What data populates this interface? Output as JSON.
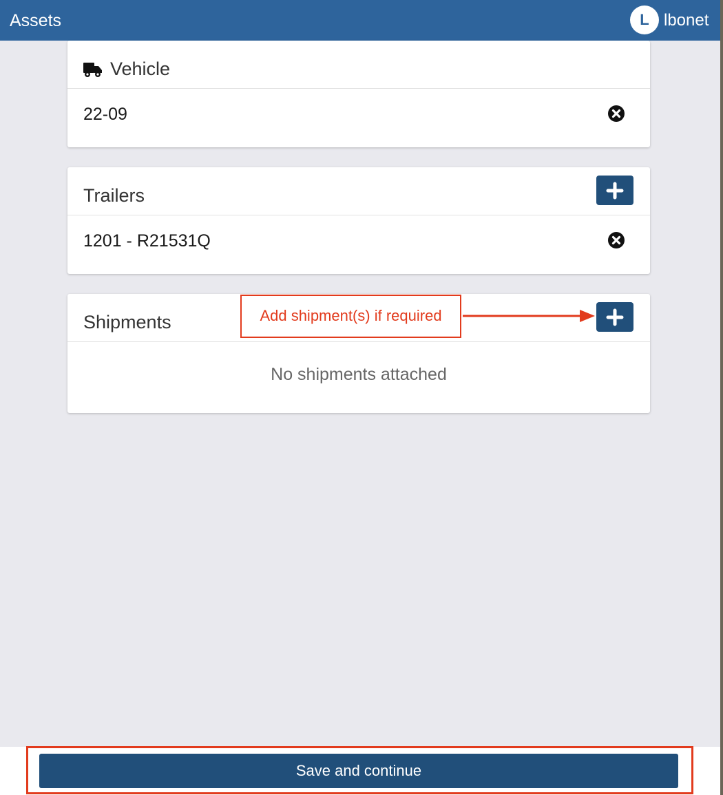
{
  "header": {
    "title": "Assets",
    "avatar_initial": "L",
    "username": "lbonet"
  },
  "vehicle": {
    "title": "Vehicle",
    "icon": "truck-icon",
    "item": "22-09"
  },
  "trailers": {
    "title": "Trailers",
    "items": [
      "1201 - R21531Q"
    ]
  },
  "shipments": {
    "title": "Shipments",
    "empty_text": "No shipments attached"
  },
  "annotation": {
    "text": "Add shipment(s) if required",
    "color": "#e23b1d"
  },
  "footer": {
    "save_label": "Save and continue"
  },
  "colors": {
    "header_bg": "#2e649c",
    "button_bg": "#214f7a",
    "page_bg": "#e9e9ee"
  }
}
